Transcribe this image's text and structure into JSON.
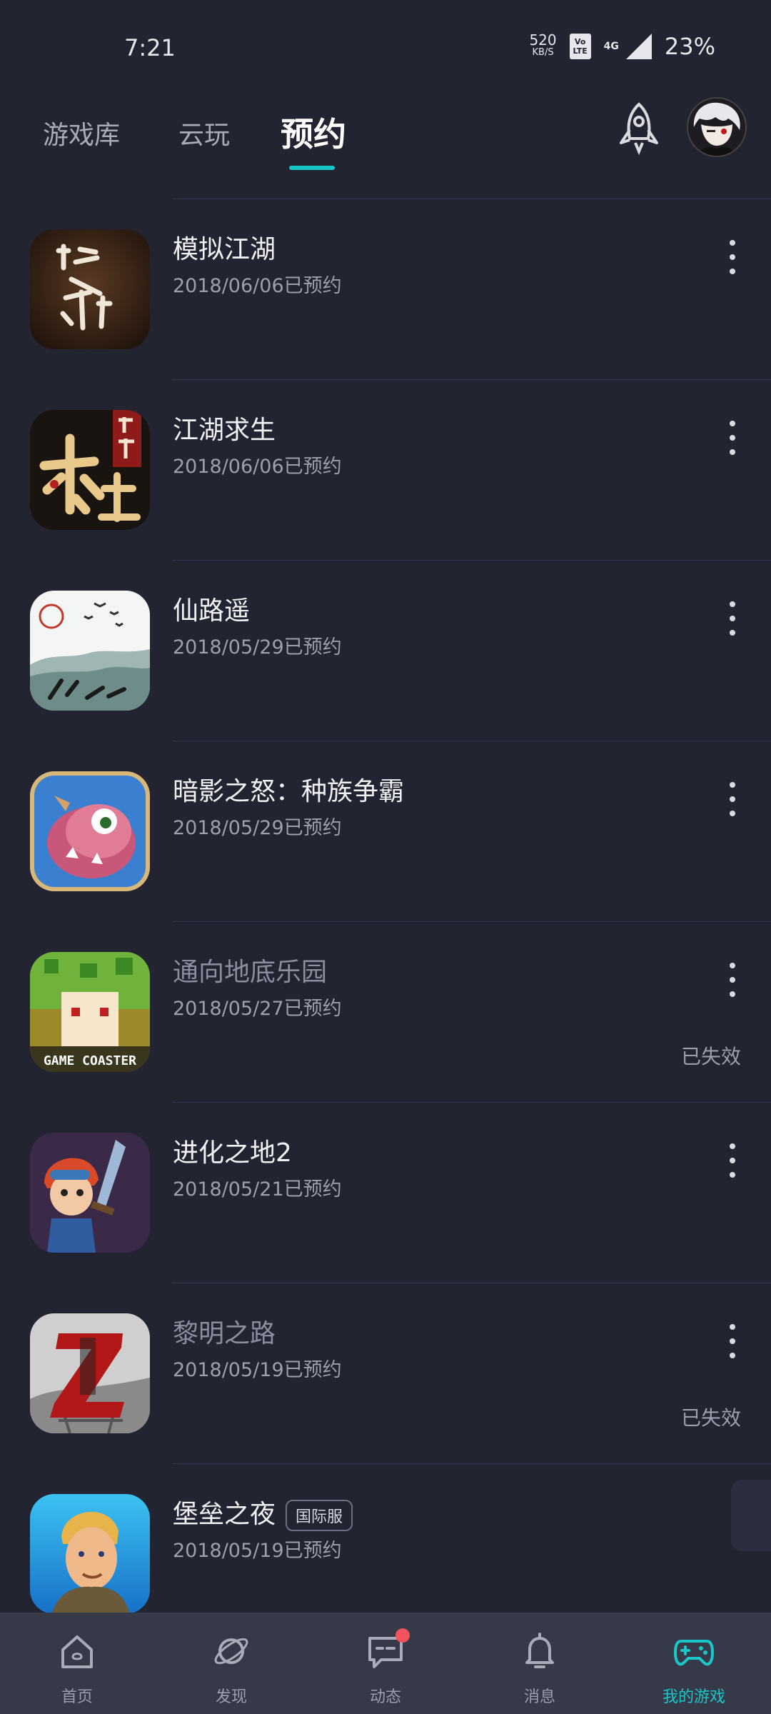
{
  "status_bar": {
    "time": "7:21",
    "speed_value": "520",
    "speed_unit": "KB/S",
    "volte": "Vo LTE",
    "network": "4G",
    "battery": "23%"
  },
  "tabs": [
    {
      "label": "游戏库"
    },
    {
      "label": "云玩"
    },
    {
      "label": "预约"
    }
  ],
  "header_icons": {
    "rocket": "rocket-icon",
    "avatar": "avatar"
  },
  "reservations": [
    {
      "name": "模拟江湖",
      "date": "2018/06/06已预约",
      "status": ""
    },
    {
      "name": "江湖求生",
      "date": "2018/06/06已预约",
      "status": ""
    },
    {
      "name": "仙路遥",
      "date": "2018/05/29已预约",
      "status": ""
    },
    {
      "name": "暗影之怒：种族争霸",
      "date": "2018/05/29已预约",
      "status": ""
    },
    {
      "name": "通向地底乐园",
      "date": "2018/05/27已预约",
      "status": "已失效"
    },
    {
      "name": "进化之地2",
      "date": "2018/05/21已预约",
      "status": ""
    },
    {
      "name": "黎明之路",
      "date": "2018/05/19已预约",
      "status": "已失效"
    },
    {
      "name": "堡垒之夜",
      "date": "2018/05/19已预约",
      "status": "",
      "badge": "国际服"
    }
  ],
  "icon_text": {
    "game_coaster": "GAME COASTER"
  },
  "bottom_nav": [
    {
      "label": "首页",
      "icon": "home-icon"
    },
    {
      "label": "发现",
      "icon": "planet-icon"
    },
    {
      "label": "动态",
      "icon": "chat-icon"
    },
    {
      "label": "消息",
      "icon": "bell-icon"
    },
    {
      "label": "我的游戏",
      "icon": "gamepad-icon"
    }
  ],
  "colors": {
    "accent": "#19c6c8",
    "background": "#222432",
    "nav_bg": "#363948",
    "notification_dot": "#f0535c"
  }
}
